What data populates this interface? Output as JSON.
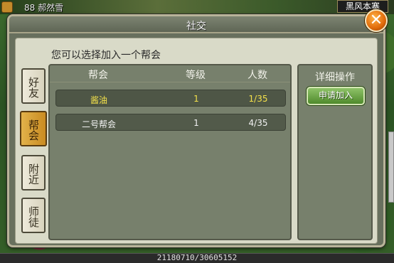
{
  "game": {
    "player_name": "88 郝然雪",
    "map_name": "黑风本寨",
    "exp_counter": "21180710/30605152"
  },
  "dialog": {
    "title": "社交",
    "close_label": "✕",
    "prompt": "您可以选择加入一个帮会"
  },
  "tabs": [
    {
      "label": "好友",
      "active": false
    },
    {
      "label": "帮会",
      "active": true
    },
    {
      "label": "附近",
      "active": false
    },
    {
      "label": "师徒",
      "active": false
    }
  ],
  "guild_list": {
    "headers": {
      "name": "帮会",
      "level": "等级",
      "count": "人数"
    },
    "rows": [
      {
        "name": "酱油",
        "level": "1",
        "count": "1/35",
        "selected": true
      },
      {
        "name": "二号帮会",
        "level": "1",
        "count": "4/35",
        "selected": false
      }
    ]
  },
  "operations": {
    "title": "详细操作",
    "apply_label": "申请加入"
  },
  "colors": {
    "selected_row_text": "#f4e14a",
    "active_tab": "#d39b30",
    "apply_button": "#5f9a38",
    "close_button": "#e06a0a"
  }
}
